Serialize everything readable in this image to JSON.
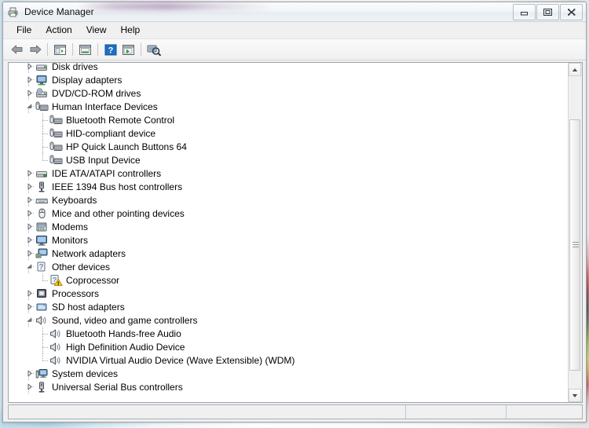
{
  "window": {
    "title": "Device Manager",
    "icon": "device-manager-icon",
    "buttons": {
      "minimize": "Minimize",
      "restore": "Restore",
      "close": "Close"
    }
  },
  "menubar": {
    "items": [
      {
        "label": "File"
      },
      {
        "label": "Action"
      },
      {
        "label": "View"
      },
      {
        "label": "Help"
      }
    ]
  },
  "toolbar": {
    "buttons": [
      {
        "name": "back-icon",
        "title": "Back"
      },
      {
        "name": "forward-icon",
        "title": "Forward"
      },
      {
        "name": "show-hide-console-tree-icon",
        "title": "Show/Hide Console Tree"
      },
      {
        "name": "properties-icon",
        "title": "Properties"
      },
      {
        "name": "help-icon",
        "title": "Help"
      },
      {
        "name": "update-driver-icon",
        "title": "Update Driver Software"
      },
      {
        "name": "scan-for-hardware-changes-icon",
        "title": "Scan for hardware changes"
      }
    ]
  },
  "tree": {
    "nodes": [
      {
        "label": "Disk drives",
        "level": 0,
        "state": "collapsed",
        "icon": "disk-drive-icon"
      },
      {
        "label": "Display adapters",
        "level": 0,
        "state": "collapsed",
        "icon": "display-adapter-icon"
      },
      {
        "label": "DVD/CD-ROM drives",
        "level": 0,
        "state": "collapsed",
        "icon": "dvd-drive-icon"
      },
      {
        "label": "Human Interface Devices",
        "level": 0,
        "state": "expanded",
        "icon": "hid-icon"
      },
      {
        "label": "Bluetooth Remote Control",
        "level": 1,
        "state": "leaf",
        "icon": "hid-icon"
      },
      {
        "label": "HID-compliant device",
        "level": 1,
        "state": "leaf",
        "icon": "hid-icon"
      },
      {
        "label": "HP Quick Launch Buttons 64",
        "level": 1,
        "state": "leaf",
        "icon": "hid-icon"
      },
      {
        "label": "USB Input Device",
        "level": 1,
        "state": "leaf",
        "icon": "hid-icon"
      },
      {
        "label": "IDE ATA/ATAPI controllers",
        "level": 0,
        "state": "collapsed",
        "icon": "ide-controller-icon"
      },
      {
        "label": "IEEE 1394 Bus host controllers",
        "level": 0,
        "state": "collapsed",
        "icon": "ieee1394-icon"
      },
      {
        "label": "Keyboards",
        "level": 0,
        "state": "collapsed",
        "icon": "keyboard-icon"
      },
      {
        "label": "Mice and other pointing devices",
        "level": 0,
        "state": "collapsed",
        "icon": "mouse-icon"
      },
      {
        "label": "Modems",
        "level": 0,
        "state": "collapsed",
        "icon": "modem-icon"
      },
      {
        "label": "Monitors",
        "level": 0,
        "state": "collapsed",
        "icon": "monitor-icon"
      },
      {
        "label": "Network adapters",
        "level": 0,
        "state": "collapsed",
        "icon": "network-adapter-icon"
      },
      {
        "label": "Other devices",
        "level": 0,
        "state": "expanded",
        "icon": "other-devices-icon"
      },
      {
        "label": "Coprocessor",
        "level": 1,
        "state": "leaf",
        "icon": "unknown-device-warning-icon"
      },
      {
        "label": "Processors",
        "level": 0,
        "state": "collapsed",
        "icon": "processor-icon"
      },
      {
        "label": "SD host adapters",
        "level": 0,
        "state": "collapsed",
        "icon": "sd-host-adapter-icon"
      },
      {
        "label": "Sound, video and game controllers",
        "level": 0,
        "state": "expanded",
        "icon": "sound-controller-icon"
      },
      {
        "label": "Bluetooth Hands-free Audio",
        "level": 1,
        "state": "leaf",
        "icon": "sound-controller-icon"
      },
      {
        "label": "High Definition Audio Device",
        "level": 1,
        "state": "leaf",
        "icon": "sound-controller-icon"
      },
      {
        "label": "NVIDIA Virtual Audio Device (Wave Extensible) (WDM)",
        "level": 1,
        "state": "leaf",
        "icon": "sound-controller-icon"
      },
      {
        "label": "System devices",
        "level": 0,
        "state": "collapsed",
        "icon": "system-device-icon"
      },
      {
        "label": "Universal Serial Bus controllers",
        "level": 0,
        "state": "collapsed",
        "icon": "usb-controller-icon"
      }
    ]
  },
  "scrollbar": {
    "up_arrow": "scroll-up-arrow",
    "down_arrow": "scroll-down-arrow",
    "thumb": "scroll-thumb"
  },
  "statusbar": {
    "panes": [
      "",
      "",
      ""
    ]
  },
  "colors": {
    "window_bg": "#f0f0f0",
    "client_bg": "#ffffff",
    "text": "#000000",
    "frame_border": "#9ba4ad",
    "warning_badge": "#ffcc00",
    "help_icon_blue": "#1f6fc4"
  }
}
